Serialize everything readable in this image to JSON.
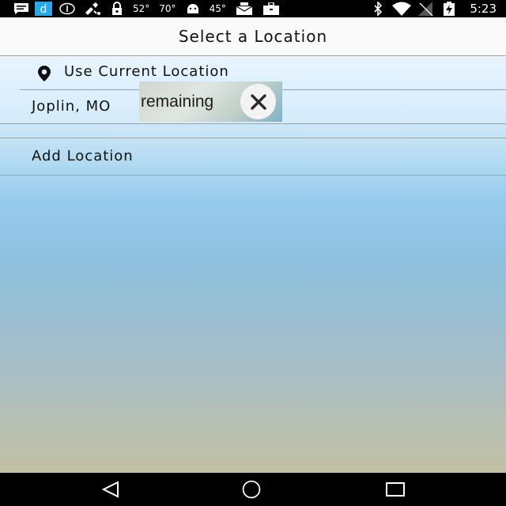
{
  "status_bar": {
    "time": "5:23",
    "temps": [
      "52°",
      "70°",
      "45°"
    ],
    "icons": [
      "message-icon",
      "app-d-icon",
      "info-icon",
      "satellite-icon",
      "lock-icon",
      "android-icon",
      "mail-icon",
      "briefcase-icon",
      "bluetooth-icon",
      "wifi-icon",
      "no-signal-icon",
      "battery-charging-icon"
    ]
  },
  "header": {
    "title": "Select a Location"
  },
  "locations": {
    "current_label": "Use Current Location",
    "current_icon": "location-pin-icon",
    "saved": "Joplin, MO",
    "add_label": "Add Location"
  },
  "ad": {
    "text": "remaining",
    "close_icon": "close-icon"
  },
  "navbar": {
    "icons": [
      "back-icon",
      "home-icon",
      "recents-icon"
    ]
  },
  "colors": {
    "accent_header": "#fafafa",
    "sky_top": "#e7f4fd",
    "sky_bottom": "#c3c0a3"
  }
}
